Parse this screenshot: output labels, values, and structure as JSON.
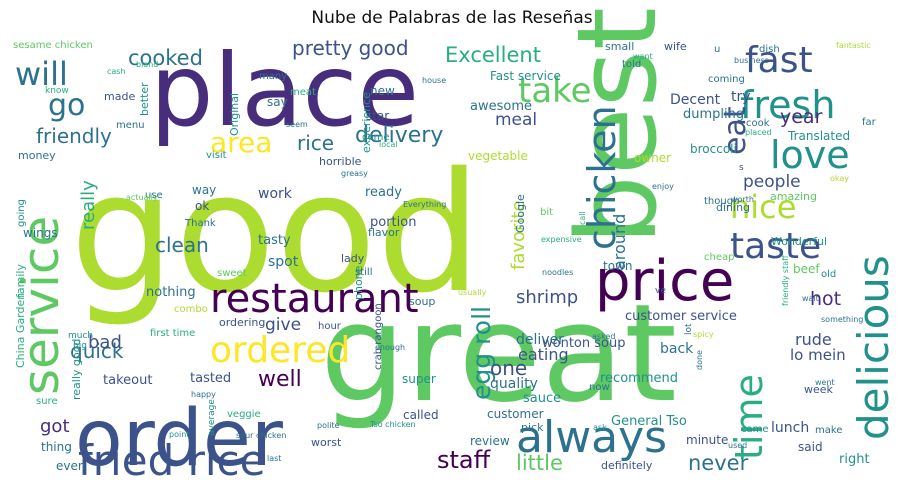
{
  "chart_data": {
    "type": "wordcloud",
    "title": "Nube de Palabras de las Reseñas",
    "background": "#ffffff",
    "palette": "viridis",
    "words": [
      {
        "text": "good",
        "weight": 100
      },
      {
        "text": "great",
        "weight": 88
      },
      {
        "text": "place",
        "weight": 64
      },
      {
        "text": "best",
        "weight": 55
      },
      {
        "text": "order",
        "weight": 50
      },
      {
        "text": "service",
        "weight": 40
      },
      {
        "text": "price",
        "weight": 36
      },
      {
        "text": "always",
        "weight": 32
      },
      {
        "text": "delicious",
        "weight": 32
      },
      {
        "text": "fried rice",
        "weight": 31
      },
      {
        "text": "restaurant",
        "weight": 30
      },
      {
        "text": "chicken",
        "weight": 28
      },
      {
        "text": "time",
        "weight": 27
      },
      {
        "text": "fresh",
        "weight": 24
      },
      {
        "text": "taste",
        "weight": 24
      },
      {
        "text": "love",
        "weight": 24
      },
      {
        "text": "ordered",
        "weight": 24
      },
      {
        "text": "fast",
        "weight": 24
      },
      {
        "text": "will",
        "weight": 22
      },
      {
        "text": "take",
        "weight": 22
      },
      {
        "text": "nice",
        "weight": 21
      },
      {
        "text": "go",
        "weight": 21
      },
      {
        "text": "eat",
        "weight": 20
      },
      {
        "text": "area",
        "weight": 17
      },
      {
        "text": "egg roll",
        "weight": 16
      },
      {
        "text": "staff",
        "weight": 15
      },
      {
        "text": "delivery",
        "weight": 14
      },
      {
        "text": "well",
        "weight": 14
      },
      {
        "text": "pretty good",
        "weight": 13
      },
      {
        "text": "Excellent",
        "weight": 13
      },
      {
        "text": "little",
        "weight": 13
      },
      {
        "text": "never",
        "weight": 13
      },
      {
        "text": "cooked",
        "weight": 12
      },
      {
        "text": "friendly",
        "weight": 12
      },
      {
        "text": "rice",
        "weight": 12
      },
      {
        "text": "clean",
        "weight": 12
      },
      {
        "text": "shrimp",
        "weight": 12
      },
      {
        "text": "quick",
        "weight": 12
      },
      {
        "text": "bad",
        "weight": 11
      },
      {
        "text": "year",
        "weight": 11
      },
      {
        "text": "people",
        "weight": 11
      },
      {
        "text": "one",
        "weight": 11
      },
      {
        "text": "hot",
        "weight": 11
      },
      {
        "text": "got",
        "weight": 11
      },
      {
        "text": "favorite",
        "weight": 10
      },
      {
        "text": "really",
        "weight": 10
      },
      {
        "text": "meal",
        "weight": 10
      },
      {
        "text": "around",
        "weight": 10
      },
      {
        "text": "give",
        "weight": 10
      },
      {
        "text": "lo mein",
        "weight": 9
      },
      {
        "text": "eating",
        "weight": 9
      },
      {
        "text": "rude",
        "weight": 9
      },
      {
        "text": "Fast service",
        "weight": 8
      },
      {
        "text": "awesome",
        "weight": 8
      },
      {
        "text": "Decent",
        "weight": 8
      },
      {
        "text": "try",
        "weight": 8
      },
      {
        "text": "customer service",
        "weight": 8
      },
      {
        "text": "quality",
        "weight": 8
      },
      {
        "text": "back",
        "weight": 8
      },
      {
        "text": "deliver",
        "weight": 8
      },
      {
        "text": "tasted",
        "weight": 8
      },
      {
        "text": "takeout",
        "weight": 8
      },
      {
        "text": "ready",
        "weight": 8
      },
      {
        "text": "work",
        "weight": 8
      },
      {
        "text": "portion",
        "weight": 8
      },
      {
        "text": "tasty",
        "weight": 8
      },
      {
        "text": "spot",
        "weight": 8
      },
      {
        "text": "nothing",
        "weight": 7
      },
      {
        "text": "ordering",
        "weight": 7
      },
      {
        "text": "lunch",
        "weight": 7
      },
      {
        "text": "sauce",
        "weight": 7
      },
      {
        "text": "recommend",
        "weight": 7
      },
      {
        "text": "wonton soup",
        "weight": 7
      },
      {
        "text": "General Tso",
        "weight": 7
      },
      {
        "text": "customer",
        "weight": 7
      },
      {
        "text": "review",
        "weight": 7
      },
      {
        "text": "definitely",
        "weight": 7
      },
      {
        "text": "minute",
        "weight": 7
      },
      {
        "text": "right",
        "weight": 7
      },
      {
        "text": "said",
        "weight": 7
      },
      {
        "text": "super",
        "weight": 7
      },
      {
        "text": "thing",
        "weight": 7
      },
      {
        "text": "called",
        "weight": 6
      },
      {
        "text": "pick",
        "weight": 6
      },
      {
        "text": "even",
        "weight": 6
      },
      {
        "text": "Google",
        "weight": 6
      },
      {
        "text": "dumpling",
        "weight": 6
      },
      {
        "text": "broccoli",
        "weight": 6
      },
      {
        "text": "Translated",
        "weight": 6
      },
      {
        "text": "owner",
        "weight": 6
      },
      {
        "text": "vegetable",
        "weight": 6
      },
      {
        "text": "small",
        "weight": 6
      },
      {
        "text": "wife",
        "weight": 6
      },
      {
        "text": "new",
        "weight": 6
      },
      {
        "text": "star",
        "weight": 6
      },
      {
        "text": "say",
        "weight": 6
      },
      {
        "text": "Original",
        "weight": 6
      },
      {
        "text": "experience",
        "weight": 6
      },
      {
        "text": "made",
        "weight": 6
      },
      {
        "text": "wings",
        "weight": 6
      },
      {
        "text": "money",
        "weight": 6
      },
      {
        "text": "flavor",
        "weight": 6
      },
      {
        "text": "phone",
        "weight": 6
      },
      {
        "text": "lady",
        "weight": 6
      },
      {
        "text": "dining",
        "weight": 5
      },
      {
        "text": "town",
        "weight": 5
      },
      {
        "text": "soup",
        "weight": 5
      },
      {
        "text": "beef",
        "weight": 5
      },
      {
        "text": "crab rangoon",
        "weight": 5
      },
      {
        "text": "way",
        "weight": 5
      },
      {
        "text": "ok",
        "weight": 5
      },
      {
        "text": "horrible",
        "weight": 5
      },
      {
        "text": "Wonderful",
        "weight": 5
      },
      {
        "text": "cheap",
        "weight": 5
      },
      {
        "text": "hour",
        "weight": 5
      },
      {
        "text": "week",
        "weight": 5
      },
      {
        "text": "veggie",
        "weight": 5
      },
      {
        "text": "worst",
        "weight": 5
      },
      {
        "text": "first time",
        "weight": 5
      },
      {
        "text": "sesame chicken",
        "weight": 4
      },
      {
        "text": "China Garden",
        "weight": 4
      },
      {
        "text": "family",
        "weight": 4
      },
      {
        "text": "going",
        "weight": 4
      },
      {
        "text": "really good",
        "weight": 4
      },
      {
        "text": "better",
        "weight": 4
      },
      {
        "text": "Thank",
        "weight": 4
      },
      {
        "text": "use",
        "weight": 4
      },
      {
        "text": "sweet",
        "weight": 4
      },
      {
        "text": "combo",
        "weight": 4
      },
      {
        "text": "still",
        "weight": 4
      },
      {
        "text": "amazing",
        "weight": 4
      },
      {
        "text": "friendly staff",
        "weight": 3
      },
      {
        "text": "coming",
        "weight": 4
      },
      {
        "text": "cook",
        "weight": 4
      },
      {
        "text": "make",
        "weight": 4
      },
      {
        "text": "came",
        "weight": 4
      },
      {
        "text": "dish",
        "weight": 4
      },
      {
        "text": "many",
        "weight": 4
      },
      {
        "text": "told",
        "weight": 4
      },
      {
        "text": "menu",
        "weight": 4
      },
      {
        "text": "visit",
        "weight": 4
      },
      {
        "text": "meat",
        "weight": 4
      },
      {
        "text": "come",
        "weight": 4
      },
      {
        "text": "though",
        "weight": 4
      },
      {
        "text": "bit",
        "weight": 4
      },
      {
        "text": "now",
        "weight": 4
      },
      {
        "text": "sure",
        "weight": 4
      },
      {
        "text": "much",
        "weight": 4
      },
      {
        "text": "big",
        "weight": 4
      },
      {
        "text": "old",
        "weight": 4
      },
      {
        "text": "far",
        "weight": 4
      },
      {
        "text": "lot",
        "weight": 4
      },
      {
        "text": "know",
        "weight": 3
      },
      {
        "text": "cash",
        "weight": 3
      },
      {
        "text": "bland",
        "weight": 3
      },
      {
        "text": "house",
        "weight": 3
      },
      {
        "text": "business",
        "weight": 3
      },
      {
        "text": "want",
        "weight": 3
      },
      {
        "text": "fantastic",
        "weight": 3
      },
      {
        "text": "seem",
        "weight": 3
      },
      {
        "text": "local",
        "weight": 3
      },
      {
        "text": "placed",
        "weight": 3
      },
      {
        "text": "greasy",
        "weight": 3
      },
      {
        "text": "Everything",
        "weight": 3
      },
      {
        "text": "actually",
        "weight": 3
      },
      {
        "text": "enjoy",
        "weight": 3
      },
      {
        "text": "worth",
        "weight": 3
      },
      {
        "text": "okay",
        "weight": 3
      },
      {
        "text": "call",
        "weight": 3
      },
      {
        "text": "expensive",
        "weight": 3
      },
      {
        "text": "noodles",
        "weight": 3
      },
      {
        "text": "usually",
        "weight": 3
      },
      {
        "text": "wait",
        "weight": 3
      },
      {
        "text": "enough",
        "weight": 3
      },
      {
        "text": "asked",
        "weight": 3
      },
      {
        "text": "spicy",
        "weight": 3
      },
      {
        "text": "something",
        "weight": 3
      },
      {
        "text": "went",
        "weight": 3
      },
      {
        "text": "happy",
        "weight": 3
      },
      {
        "text": "average",
        "weight": 3
      },
      {
        "text": "polite",
        "weight": 3
      },
      {
        "text": "Tso chicken",
        "weight": 3
      },
      {
        "text": "sour chicken",
        "weight": 3
      },
      {
        "text": "point",
        "weight": 3
      },
      {
        "text": "last",
        "weight": 3
      },
      {
        "text": "used",
        "weight": 3
      },
      {
        "text": "done",
        "weight": 3
      },
      {
        "text": "ve",
        "weight": 3
      },
      {
        "text": "s",
        "weight": 3
      },
      {
        "text": "u",
        "weight": 3
      },
      {
        "text": "ask",
        "weight": 3
      }
    ]
  }
}
